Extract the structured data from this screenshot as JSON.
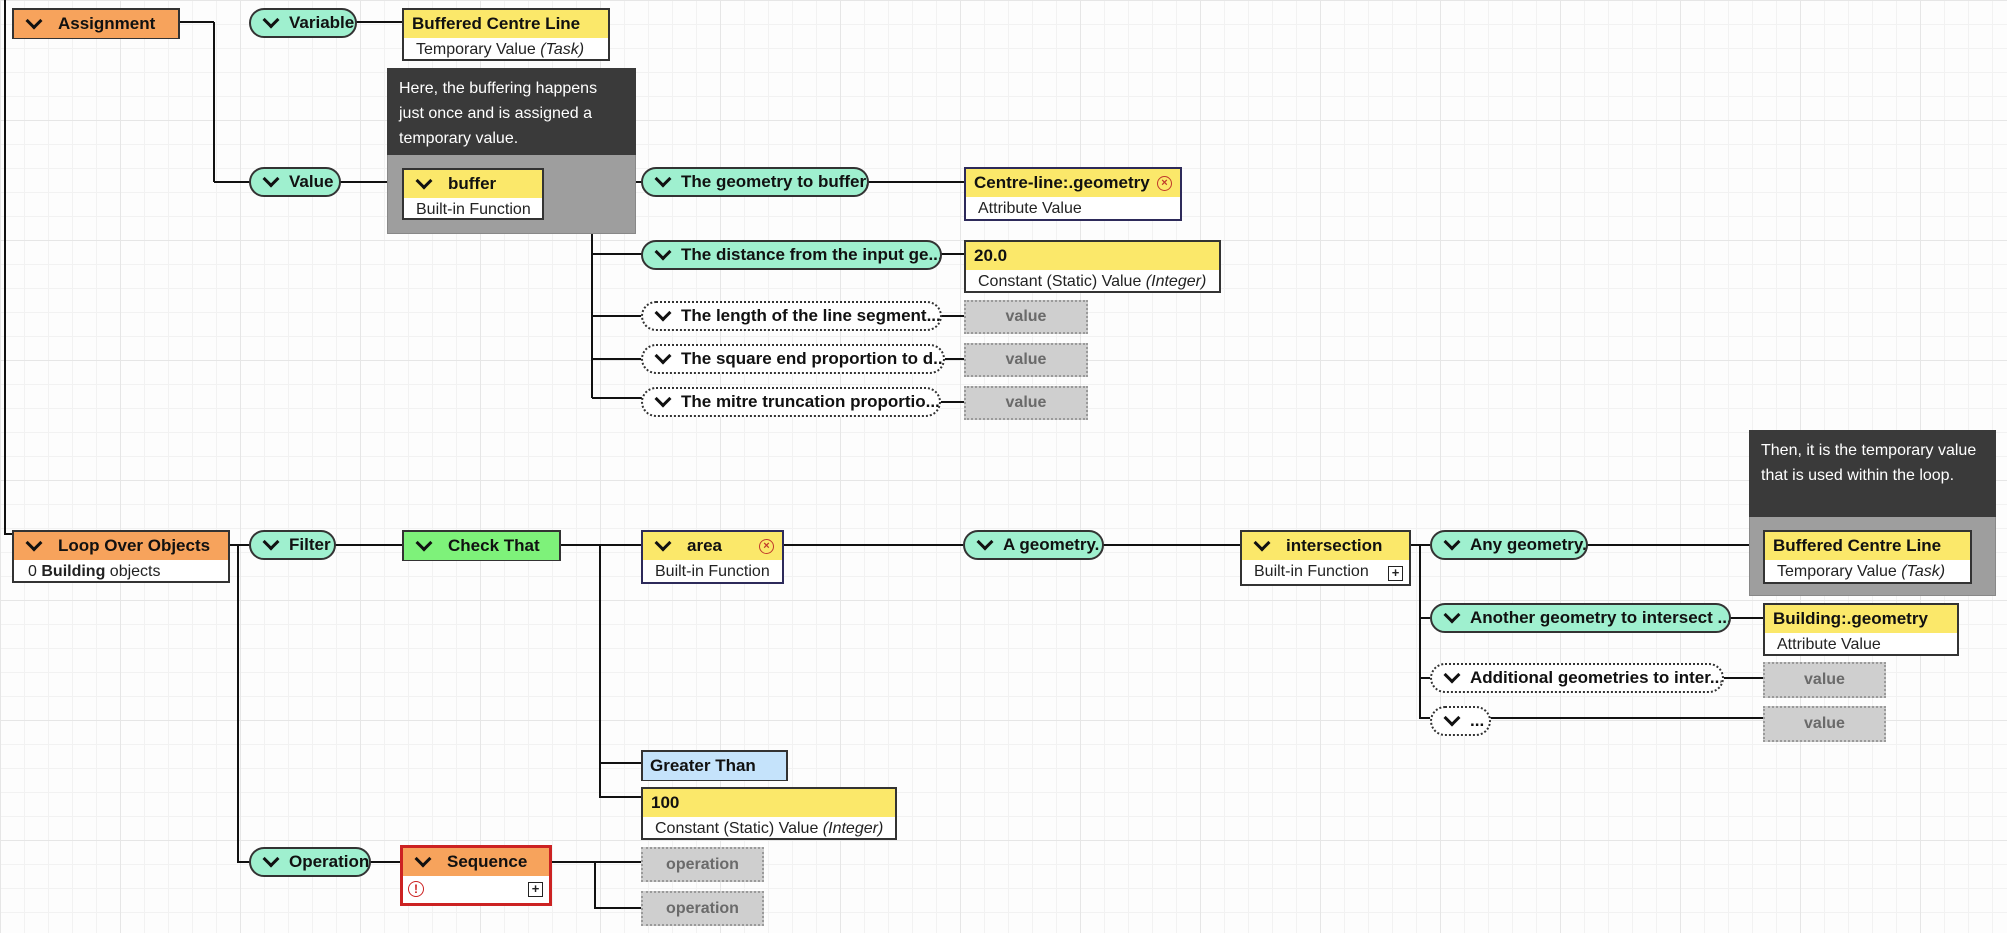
{
  "assignment": {
    "block_label": "Assignment",
    "variable_label": "Variable",
    "variable_name": "Buffered Centre Line",
    "variable_type": "Temporary Value",
    "variable_scope": "(Task)",
    "value_label": "Value",
    "comment": "Here, the buffering happens just once and is assigned a temporary value.",
    "function_name": "buffer",
    "function_type": "Built-in Function",
    "params": [
      {
        "label": "The geometry to buffer."
      },
      {
        "label": "The distance from the input ge..."
      },
      {
        "label": "The length of the line segment..."
      },
      {
        "label": "The square end proportion to d..."
      },
      {
        "label": "The mitre truncation proportio..."
      }
    ],
    "arg_geometry_name": "Centre-line:.geometry",
    "arg_geometry_type": "Attribute Value",
    "arg_distance_value": "20.0",
    "arg_distance_type": "Constant (Static) Value",
    "arg_distance_kind": "(Integer)",
    "placeholder": "value"
  },
  "loop": {
    "block_label": "Loop Over Objects",
    "count": "0",
    "object_type": "Building",
    "objects_word": "objects",
    "filter_label": "Filter",
    "check_label": "Check That",
    "area_name": "area",
    "area_type": "Built-in Function",
    "a_geometry_label": "A geometry.",
    "intersection_name": "intersection",
    "intersection_type": "Built-in Function",
    "any_geometry_label": "Any geometry.",
    "another_geometry_label": "Another geometry to intersect ...",
    "additional_label": "Additional geometries to inter...",
    "ellipsis_label": "...",
    "comment": "Then, it is the temporary value that is used within the loop.",
    "temp_name": "Buffered Centre Line",
    "temp_type": "Temporary Value",
    "temp_scope": "(Task)",
    "building_geom_name": "Building:.geometry",
    "building_geom_type": "Attribute Value",
    "placeholder": "value",
    "greater_than": "Greater Than",
    "const_value": "100",
    "const_type": "Constant (Static) Value",
    "const_kind": "(Integer)",
    "operation_label": "Operation",
    "sequence_label": "Sequence",
    "operation_placeholder": "operation"
  },
  "colors": {
    "action_block": "#f7a35c",
    "value_block": "#fbe86a",
    "condition_block": "#7ef27a",
    "comparator_block": "#c5e3fb",
    "parameter_pill": "#9ff0cf",
    "placeholder": "#cfcfcf",
    "comment": "#3a3a3a",
    "error": "#cc2222"
  },
  "icons": {
    "collapse": "chevron-down-icon",
    "remove": "close-circle-icon",
    "expand": "plus-box-icon",
    "warning": "warning-circle-icon"
  }
}
